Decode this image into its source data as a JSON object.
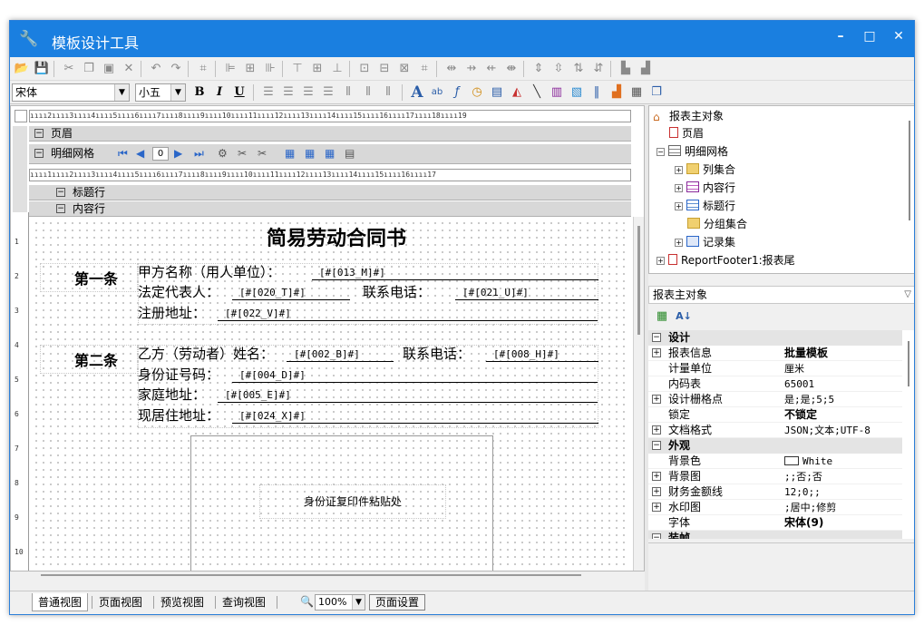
{
  "window": {
    "title": "模板设计工具",
    "min": "–",
    "max": "□",
    "close": "✕"
  },
  "toolbar2": {
    "font": "宋体",
    "size": "小五",
    "bold": "B",
    "italic": "I",
    "underline": "U"
  },
  "rulers": {
    "top": "ıııı2ıııı3ıııı4ıııı5ıııı6ıııı7ıııı8ıııı9ıııı10ıııı11ıııı12ıııı13ıııı14ıııı15ıııı16ıııı17ıııı18ıııı19",
    "grid": "ıııı1ıııı2ıııı3ıııı4ıııı5ıııı6ıııı7ıııı8ıııı9ıııı10ıııı11ıııı12ıııı13ıııı14ıııı15ıııı16ıııı17",
    "vertical": [
      "1",
      "2",
      "3",
      "4",
      "5",
      "6",
      "7",
      "8",
      "9",
      "10"
    ]
  },
  "bands": {
    "header": "页眉",
    "detail_grid": "明细网格",
    "nav_value": "0",
    "title_row": "标题行",
    "content_row": "内容行"
  },
  "report": {
    "title": "简易劳动合同书",
    "article1": "第一条",
    "a1_l1": "甲方名称（用人单位）：",
    "a1_f1": "[#[013_M]#]",
    "a1_l2": "法定代表人：",
    "a1_f2": "[#[020_T]#]",
    "a1_l3": "联系电话：",
    "a1_f3": "[#[021_U]#]",
    "a1_l4": "注册地址：",
    "a1_f4": "[#[022_V]#]",
    "article2": "第二条",
    "a2_l1": "乙方（劳动者）姓名：",
    "a2_f1": "[#[002_B]#]",
    "a2_l2": "联系电话：",
    "a2_f2": "[#[008_H]#]",
    "a2_l3": "身份证号码：",
    "a2_f3": "[#[004_D]#]",
    "a2_l4": "家庭地址：",
    "a2_f4": "[#[005_E]#]",
    "a2_l5": "现居住地址：",
    "a2_f5": "[#[024_X]#]",
    "id_note": "身份证复印件粘贴处"
  },
  "bottom": {
    "tabs": [
      "普通视图",
      "页面视图",
      "预览视图",
      "查询视图"
    ],
    "zoom": "100%",
    "page_setup": "页面设置"
  },
  "tree": {
    "root": "报表主对象",
    "header": "页眉",
    "grid": "明细网格",
    "columns": "列集合",
    "content": "内容行",
    "titlerow": "标题行",
    "groups": "分组集合",
    "records": "记录集",
    "footer": "ReportFooter1:报表尾"
  },
  "properties": {
    "selected": "报表主对象",
    "cat_design": "设计",
    "cat_appearance": "外观",
    "cat_next": "装帧",
    "rows": [
      {
        "name": "报表信息",
        "value": "批量模板",
        "bold": true,
        "expand": true
      },
      {
        "name": "计量单位",
        "value": "厘米",
        "bold": false,
        "expand": false
      },
      {
        "name": "内码表",
        "value": "65001",
        "bold": false,
        "expand": false
      },
      {
        "name": "设计栅格点",
        "value": "是;是;5;5",
        "bold": false,
        "expand": true
      },
      {
        "name": "锁定",
        "value": "不锁定",
        "bold": true,
        "expand": false
      },
      {
        "name": "文档格式",
        "value": "JSON;文本;UTF-8",
        "bold": false,
        "expand": true
      }
    ],
    "rows2": [
      {
        "name": "背景色",
        "value": "White",
        "bold": false,
        "expand": false
      },
      {
        "name": "背景图",
        "value": ";;否;否",
        "bold": false,
        "expand": true
      },
      {
        "name": "财务金额线",
        "value": "12;0;;",
        "bold": false,
        "expand": true
      },
      {
        "name": "水印图",
        "value": ";居中;修剪",
        "bold": false,
        "expand": true
      },
      {
        "name": "字体",
        "value": "宋体(9)",
        "bold": true,
        "expand": false
      }
    ]
  },
  "colors": {
    "titlebar": "#1a7fe0",
    "accent": "#2a66c8"
  }
}
